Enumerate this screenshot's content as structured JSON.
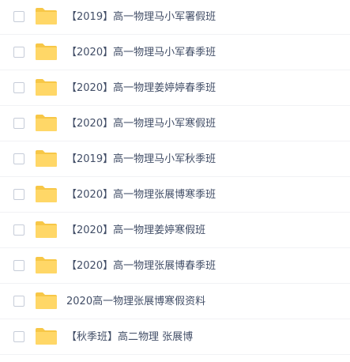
{
  "icons": {
    "folder": "folder-icon",
    "checkbox": "checkbox"
  },
  "colors": {
    "folder": "#ffd767",
    "folder_tab": "#f7c747",
    "text": "#424e67",
    "divider": "#f1f2f5"
  },
  "files": [
    {
      "name": "【2019】高一物理马小军署假班"
    },
    {
      "name": "【2020】高一物理马小军春季班"
    },
    {
      "name": "【2020】高一物理姜婷婷春季班"
    },
    {
      "name": "【2020】高一物理马小军寒假班"
    },
    {
      "name": "【2019】高一物理马小军秋季班"
    },
    {
      "name": "【2020】高一物理张展博寒季班"
    },
    {
      "name": "【2020】高一物理姜婷寒假班"
    },
    {
      "name": "【2020】高一物理张展博春季班"
    },
    {
      "name": "2020高一物理张展博寒假资料"
    },
    {
      "name": "【秋季班】高二物理 张展博"
    }
  ]
}
